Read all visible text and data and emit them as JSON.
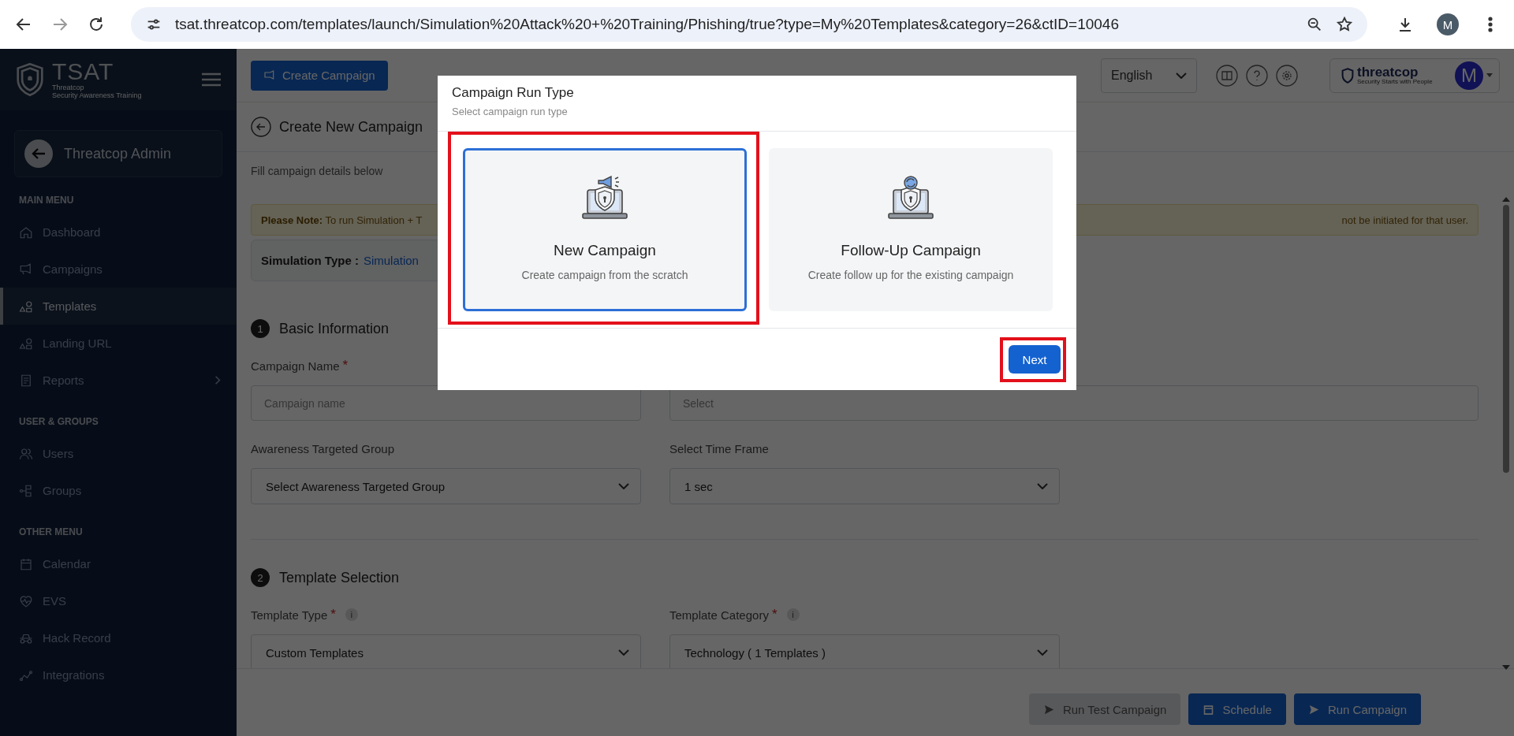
{
  "browser": {
    "url": "tsat.threatcop.com/templates/launch/Simulation%20Attack%20+%20Training/Phishing/true?type=My%20Templates&category=26&ctID=10046",
    "profile": "M"
  },
  "sidebar": {
    "logo": "TSAT",
    "tagline_1": "Threatcop",
    "tagline_2": "Security Awareness Training",
    "account": "Threatcop Admin",
    "sections": [
      {
        "heading": "MAIN MENU",
        "items": [
          {
            "label": "Dashboard",
            "selected": false,
            "submenu": false
          },
          {
            "label": "Campaigns",
            "selected": false,
            "submenu": false
          },
          {
            "label": "Templates",
            "selected": true,
            "submenu": false
          },
          {
            "label": "Landing URL",
            "selected": false,
            "submenu": false
          },
          {
            "label": "Reports",
            "selected": false,
            "submenu": true
          }
        ]
      },
      {
        "heading": "USER & GROUPS",
        "items": [
          {
            "label": "Users",
            "selected": false,
            "submenu": false
          },
          {
            "label": "Groups",
            "selected": false,
            "submenu": false
          }
        ]
      },
      {
        "heading": "OTHER MENU",
        "items": [
          {
            "label": "Calendar",
            "selected": false,
            "submenu": false
          },
          {
            "label": "EVS",
            "selected": false,
            "submenu": false
          },
          {
            "label": "Hack Record",
            "selected": false,
            "submenu": false
          },
          {
            "label": "Integrations",
            "selected": false,
            "submenu": false
          }
        ]
      }
    ]
  },
  "header": {
    "create_button": "Create Campaign",
    "language": "English",
    "brand": "threatcop",
    "brand_tagline": "Security Starts with People",
    "avatar": "M"
  },
  "page": {
    "title": "Create New Campaign",
    "subtitle": "Fill campaign details below",
    "notice": {
      "label": "Please Note:",
      "text_start": "To run Simulation + T",
      "text_end": "not be initiated for that user."
    },
    "simulation_type": {
      "label": "Simulation Type :",
      "value": "Simulation"
    },
    "sections": [
      {
        "number": "1",
        "title": "Basic Information",
        "rows": [
          [
            {
              "kind": "text",
              "label": "Campaign Name",
              "required_mark": "*",
              "placeholder": "Campaign name"
            },
            {
              "kind": "picker",
              "placeholder": "Select"
            }
          ],
          [
            {
              "kind": "select",
              "label": "Awareness Targeted Group",
              "value": "Select Awareness Targeted Group"
            },
            {
              "kind": "select",
              "label": "Select Time Frame",
              "value": "1 sec"
            }
          ]
        ]
      },
      {
        "number": "2",
        "title": "Template Selection",
        "rows": [
          [
            {
              "kind": "select",
              "label": "Template Type",
              "required_mark": "*",
              "info_mark": "i",
              "value": "Custom Templates"
            },
            {
              "kind": "select",
              "label": "Template Category",
              "required_mark": "*",
              "info_mark": "i",
              "value": "Technology ( 1 Templates )"
            }
          ]
        ]
      }
    ],
    "footer_buttons": [
      {
        "label": "Run Test Campaign",
        "disabled": true
      },
      {
        "label": "Schedule",
        "disabled": false
      },
      {
        "label": "Run Campaign",
        "disabled": false
      }
    ]
  },
  "modal": {
    "title": "Campaign Run Type",
    "subtitle": "Select campaign run type",
    "options": [
      {
        "title": "New Campaign",
        "description": "Create campaign from the scratch",
        "selected": true
      },
      {
        "title": "Follow-Up Campaign",
        "description": "Create follow up for the existing campaign",
        "selected": false
      }
    ],
    "next_button": "Next"
  }
}
